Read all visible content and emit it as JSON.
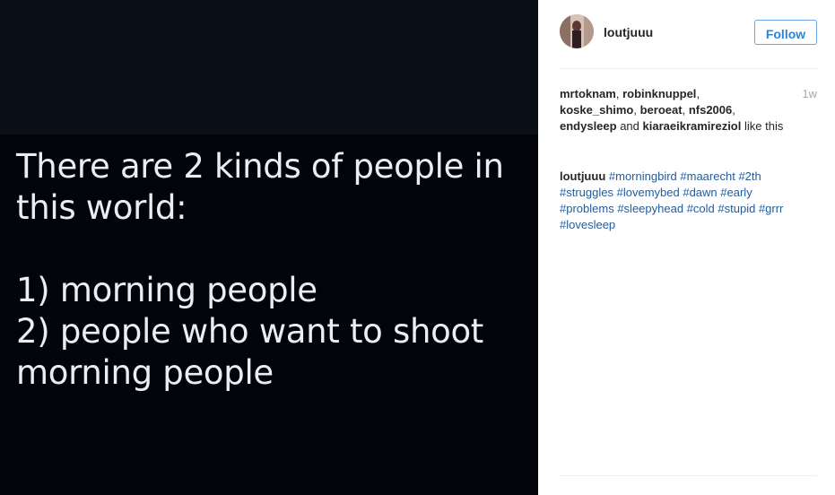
{
  "photo": {
    "text": "There are 2 kinds of people in\nthis world:\n\n1) morning people\n2) people who want to shoot\nmorning people"
  },
  "post": {
    "username": "loutjuuu",
    "follow_label": "Follow",
    "time": "1w",
    "likes": [
      {
        "name": "mrtoknam",
        "sep": ", "
      },
      {
        "name": "robinknuppel",
        "sep": ",\n"
      },
      {
        "name": "koske_shimo",
        "sep": ", "
      },
      {
        "name": "beroeat",
        "sep": ", "
      },
      {
        "name": "nfs2006",
        "sep": ",\n"
      },
      {
        "name": "endysleep",
        "sep": " and "
      },
      {
        "name": "kiaraeikramireziol",
        "sep": ""
      }
    ],
    "likes_suffix": " like this",
    "caption_author": "loutjuuu",
    "tags": [
      "#morningbird",
      "#maarecht",
      "#2th",
      "#struggles",
      "#lovemybed",
      "#dawn",
      "#early",
      "#problems",
      "#sleepyhead",
      "#cold",
      "#stupid",
      "#grrr",
      "#lovesleep"
    ]
  },
  "colors": {
    "accent": "#3897f0",
    "hashtag": "#255c98",
    "muted": "#a5a7aa"
  }
}
